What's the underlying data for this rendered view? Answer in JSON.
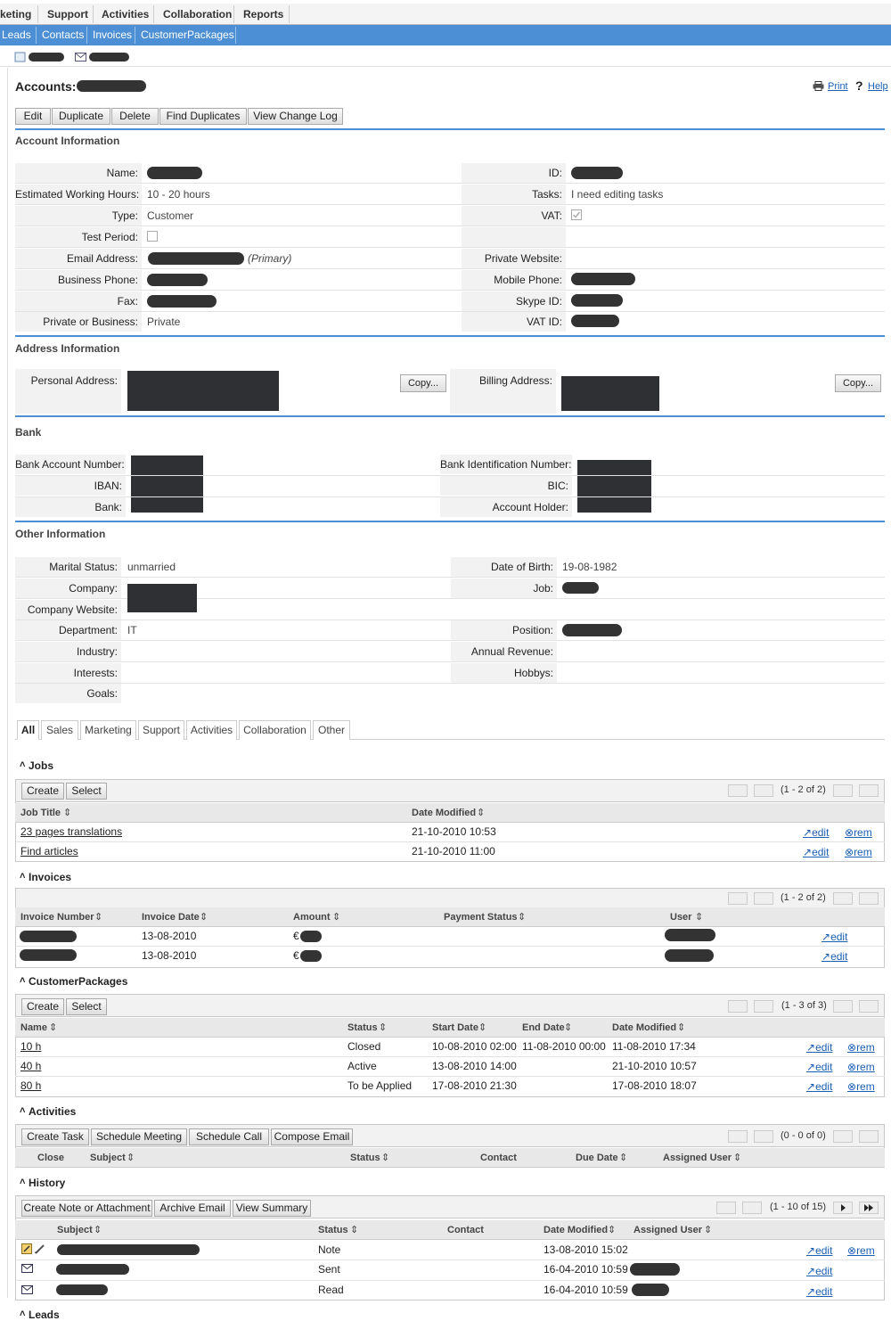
{
  "nav_modules": [
    "keting",
    "Support",
    "Activities",
    "Collaboration",
    "Reports"
  ],
  "nav_submodules": [
    "Leads",
    "Contacts",
    "Invoices",
    "CustomerPackages"
  ],
  "page": {
    "title": "Accounts:",
    "print": "Print",
    "help": "Help"
  },
  "actions": [
    "Edit",
    "Duplicate",
    "Delete",
    "Find Duplicates",
    "View Change Log"
  ],
  "account_info": {
    "heading": "Account Information",
    "name_label": "Name:",
    "id_label": "ID:",
    "ewh_label": "Estimated Working Hours:",
    "ewh_value": "10 - 20 hours",
    "tasks_label": "Tasks:",
    "tasks_value": "I need editing tasks",
    "type_label": "Type:",
    "type_value": "Customer",
    "vat_label": "VAT:",
    "test_label": "Test Period:",
    "email_label": "Email Address:",
    "email_primary": "(Primary)",
    "pw_label": "Private Website:",
    "bphone_label": "Business Phone:",
    "mphone_label": "Mobile Phone:",
    "fax_label": "Fax:",
    "skype_label": "Skype ID:",
    "pob_label": "Private or Business:",
    "pob_value": "Private",
    "vatid_label": "VAT ID:"
  },
  "address_info": {
    "heading": "Address Information",
    "personal_label": "Personal Address:",
    "billing_label": "Billing Address:",
    "copy": "Copy..."
  },
  "bank": {
    "heading": "Bank",
    "acct_label": "Bank Account Number:",
    "iban_label": "IBAN:",
    "bank_label": "Bank:",
    "bin_label": "Bank Identification Number:",
    "bic_label": "BIC:",
    "holder_label": "Account Holder:"
  },
  "other_info": {
    "heading": "Other Information",
    "marital_label": "Marital Status:",
    "marital_value": "unmarried",
    "dob_label": "Date of Birth:",
    "dob_value": "19-08-1982",
    "company_label": "Company:",
    "job_label": "Job:",
    "cweb_label": "Company Website:",
    "dept_label": "Department:",
    "dept_value": "IT",
    "position_label": "Position:",
    "industry_label": "Industry:",
    "revenue_label": "Annual Revenue:",
    "interests_label": "Interests:",
    "hobbys_label": "Hobbys:",
    "goals_label": "Goals:"
  },
  "tabs": [
    "All",
    "Sales",
    "Marketing",
    "Support",
    "Activities",
    "Collaboration",
    "Other"
  ],
  "jobs": {
    "title": "Jobs",
    "buttons": [
      "Create",
      "Select"
    ],
    "pager": "(1 - 2 of 2)",
    "columns": [
      "Job Title",
      "Date Modified"
    ],
    "rows": [
      {
        "title": "23 pages translations",
        "date": "21-10-2010 10:53"
      },
      {
        "title": "Find articles",
        "date": "21-10-2010 11:00"
      }
    ]
  },
  "invoices": {
    "title": "Invoices",
    "pager": "(1 - 2 of 2)",
    "columns": [
      "Invoice Number",
      "Invoice Date",
      "Amount",
      "Payment Status",
      "User"
    ],
    "rows": [
      {
        "date": "13-08-2010",
        "amount": "€"
      },
      {
        "date": "13-08-2010",
        "amount": "€"
      }
    ]
  },
  "packages": {
    "title": "CustomerPackages",
    "buttons": [
      "Create",
      "Select"
    ],
    "pager": "(1 - 3 of 3)",
    "columns": [
      "Name",
      "Status",
      "Start Date",
      "End Date",
      "Date Modified"
    ],
    "rows": [
      {
        "name": "10 h",
        "status": "Closed",
        "start": "10-08-2010 02:00",
        "end": "11-08-2010 00:00",
        "modified": "11-08-2010 17:34"
      },
      {
        "name": "40 h",
        "status": "Active",
        "start": "13-08-2010 14:00",
        "end": "",
        "modified": "21-10-2010 10:57"
      },
      {
        "name": "80 h",
        "status": "To be Applied",
        "start": "17-08-2010 21:30",
        "end": "",
        "modified": "17-08-2010 18:07"
      }
    ]
  },
  "activities": {
    "title": "Activities",
    "buttons": [
      "Create Task",
      "Schedule Meeting",
      "Schedule Call",
      "Compose Email"
    ],
    "pager": "(0 - 0 of 0)",
    "columns": [
      "Close",
      "Subject",
      "Status",
      "Contact",
      "Due Date",
      "Assigned User"
    ]
  },
  "history": {
    "title": "History",
    "buttons": [
      "Create Note or Attachment",
      "Archive Email",
      "View Summary"
    ],
    "pager": "(1 - 10 of 15)",
    "columns": [
      "Subject",
      "Status",
      "Contact",
      "Date Modified",
      "Assigned User"
    ],
    "rows": [
      {
        "status": "Note",
        "date": "13-08-2010 15:02"
      },
      {
        "status": "Sent",
        "date": "16-04-2010 10:59"
      },
      {
        "status": "Read",
        "date": "16-04-2010 10:59"
      }
    ]
  },
  "leads_title": "Leads",
  "edit_label": "edit",
  "rem_label": "rem"
}
